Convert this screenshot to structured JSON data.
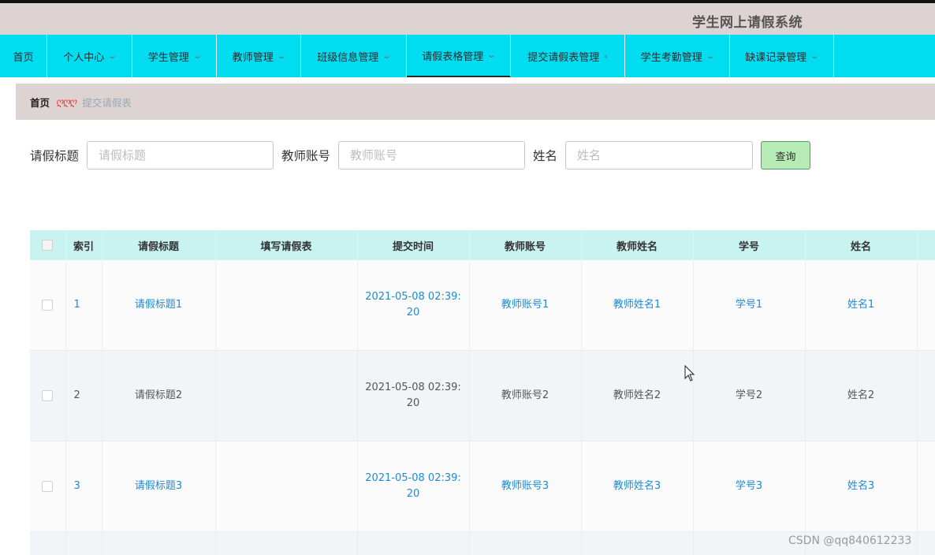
{
  "app": {
    "title": "学生网上请假系统"
  },
  "nav": {
    "items": [
      {
        "label": "首页",
        "chevron": ""
      },
      {
        "label": "个人中心",
        "chevron": "chevron-down"
      },
      {
        "label": "学生管理",
        "chevron": "chevron-down"
      },
      {
        "label": "教师管理",
        "chevron": "chevron-down"
      },
      {
        "label": "班级信息管理",
        "chevron": "chevron-down"
      },
      {
        "label": "请假表格管理",
        "chevron": "chevron-down"
      },
      {
        "label": "提交请假表管理",
        "chevron": "chevron-left"
      },
      {
        "label": "学生考勤管理",
        "chevron": "chevron-down"
      },
      {
        "label": "缺课记录管理",
        "chevron": "chevron-down"
      }
    ],
    "active_label": "请假表格管理"
  },
  "breadcrumb": {
    "home": "首页",
    "separator": "ღღღ",
    "current": "提交请假表"
  },
  "search": {
    "title_label": "请假标题",
    "title_placeholder": "请假标题",
    "teacher_label": "教师账号",
    "teacher_placeholder": "教师账号",
    "name_label": "姓名",
    "name_placeholder": "姓名",
    "query_button": "查询"
  },
  "table": {
    "headers": [
      "索引",
      "请假标题",
      "填写请假表",
      "提交时间",
      "教师账号",
      "教师姓名",
      "学号",
      "姓名"
    ],
    "rows": [
      {
        "index": "1",
        "title": "请假标题1",
        "form": "",
        "time": "2021-05-08 02:39:20",
        "teacher_account": "教师账号1",
        "teacher_name": "教师姓名1",
        "student_no": "学号1",
        "name": "姓名1"
      },
      {
        "index": "2",
        "title": "请假标题2",
        "form": "",
        "time": "2021-05-08 02:39:20",
        "teacher_account": "教师账号2",
        "teacher_name": "教师姓名2",
        "student_no": "学号2",
        "name": "姓名2"
      },
      {
        "index": "3",
        "title": "请假标题3",
        "form": "",
        "time": "2021-05-08 02:39:20",
        "teacher_account": "教师账号3",
        "teacher_name": "教师姓名3",
        "student_no": "学号3",
        "name": "姓名3"
      }
    ]
  },
  "watermark": "CSDN @qq840612233",
  "colors": {
    "nav_bg": "#00dcf0",
    "header_bg": "#ddd3d3",
    "link": "#1e8ad3",
    "table_header": "#c8f3f1",
    "query_button": "#b6ebb5"
  }
}
